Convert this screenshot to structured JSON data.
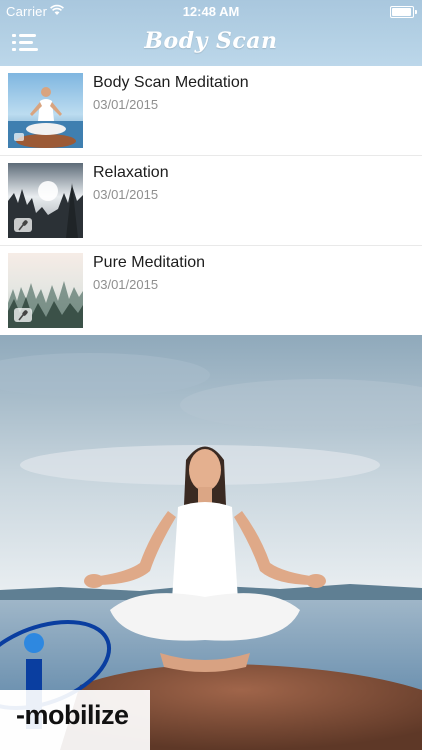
{
  "status_bar": {
    "carrier": "Carrier",
    "time": "12:48 AM",
    "wifi_icon": "wifi-icon",
    "battery_icon": "battery-icon"
  },
  "nav": {
    "title": "Body Scan",
    "menu_icon": "menu-icon"
  },
  "tracks": [
    {
      "title": "Body Scan Meditation",
      "date": "03/01/2015",
      "thumbnail": "meditating-woman-thumbnail"
    },
    {
      "title": "Relaxation",
      "date": "03/01/2015",
      "thumbnail": "misty-forest-thumbnail",
      "badge_icon": "microphone-icon"
    },
    {
      "title": "Pure Meditation",
      "date": "03/01/2015",
      "thumbnail": "foggy-pines-thumbnail",
      "badge_icon": "microphone-icon"
    }
  ],
  "hero": {
    "image": "woman-meditating-on-rock-by-lake",
    "logo_text": "-mobilize"
  },
  "colors": {
    "header": "#b3d0e4",
    "title_text": "#1d1d1d",
    "date_text": "#8f8f8f",
    "divider": "#e9e9e9"
  }
}
